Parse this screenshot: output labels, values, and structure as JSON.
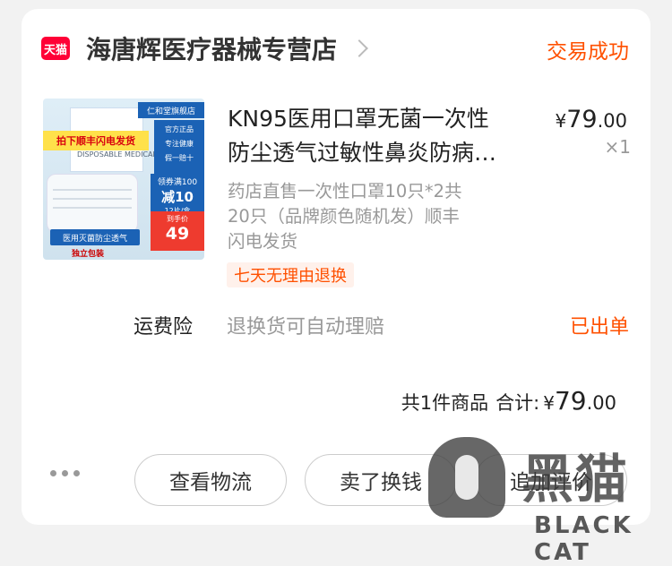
{
  "store": {
    "badge": "天猫",
    "name": "海唐辉医疗器械专营店",
    "order_status": "交易成功"
  },
  "product": {
    "image_text": {
      "brand": "仁和堂旗舰店",
      "ribbon": "拍下顺丰闪电发货",
      "box_label": "DISPOSABLE MEDICAL MASK",
      "tags": [
        "官方正品",
        "专注健康",
        "假一赔十"
      ],
      "coupon_line1": "领券满100",
      "coupon_line2": "减10",
      "coupon_line3": "12片/盒",
      "price_label": "到手价",
      "price_value": "49",
      "strip": "医用灭菌防尘透气",
      "pack": "独立包装"
    },
    "title_line1": "KN95医用口罩无菌一次性",
    "title_line2": "防尘透气过敏性鼻炎防病…",
    "desc_line1": "药店直售一次性口罩10只*2共",
    "desc_line2": "20只（品牌颜色随机发）顺丰",
    "desc_line3": "闪电发货",
    "price_currency": "¥",
    "price_int": "79",
    "price_dec": ".00",
    "quantity": "×1",
    "return_tag": "七天无理由退换"
  },
  "insurance": {
    "label": "运费险",
    "text": "退换货可自动理赔",
    "status": "已出单"
  },
  "summary": {
    "count": "共1件商品",
    "total_label": "合计:",
    "total_currency": "¥",
    "total_int": "79",
    "total_dec": ".00"
  },
  "actions": {
    "logistics": "查看物流",
    "resell": "卖了换钱",
    "review": "追加评价"
  },
  "watermark": {
    "cn": "黑猫",
    "en": "BLACK CAT"
  },
  "colors": {
    "accent": "#ff5000",
    "tmall": "#ff0036"
  }
}
